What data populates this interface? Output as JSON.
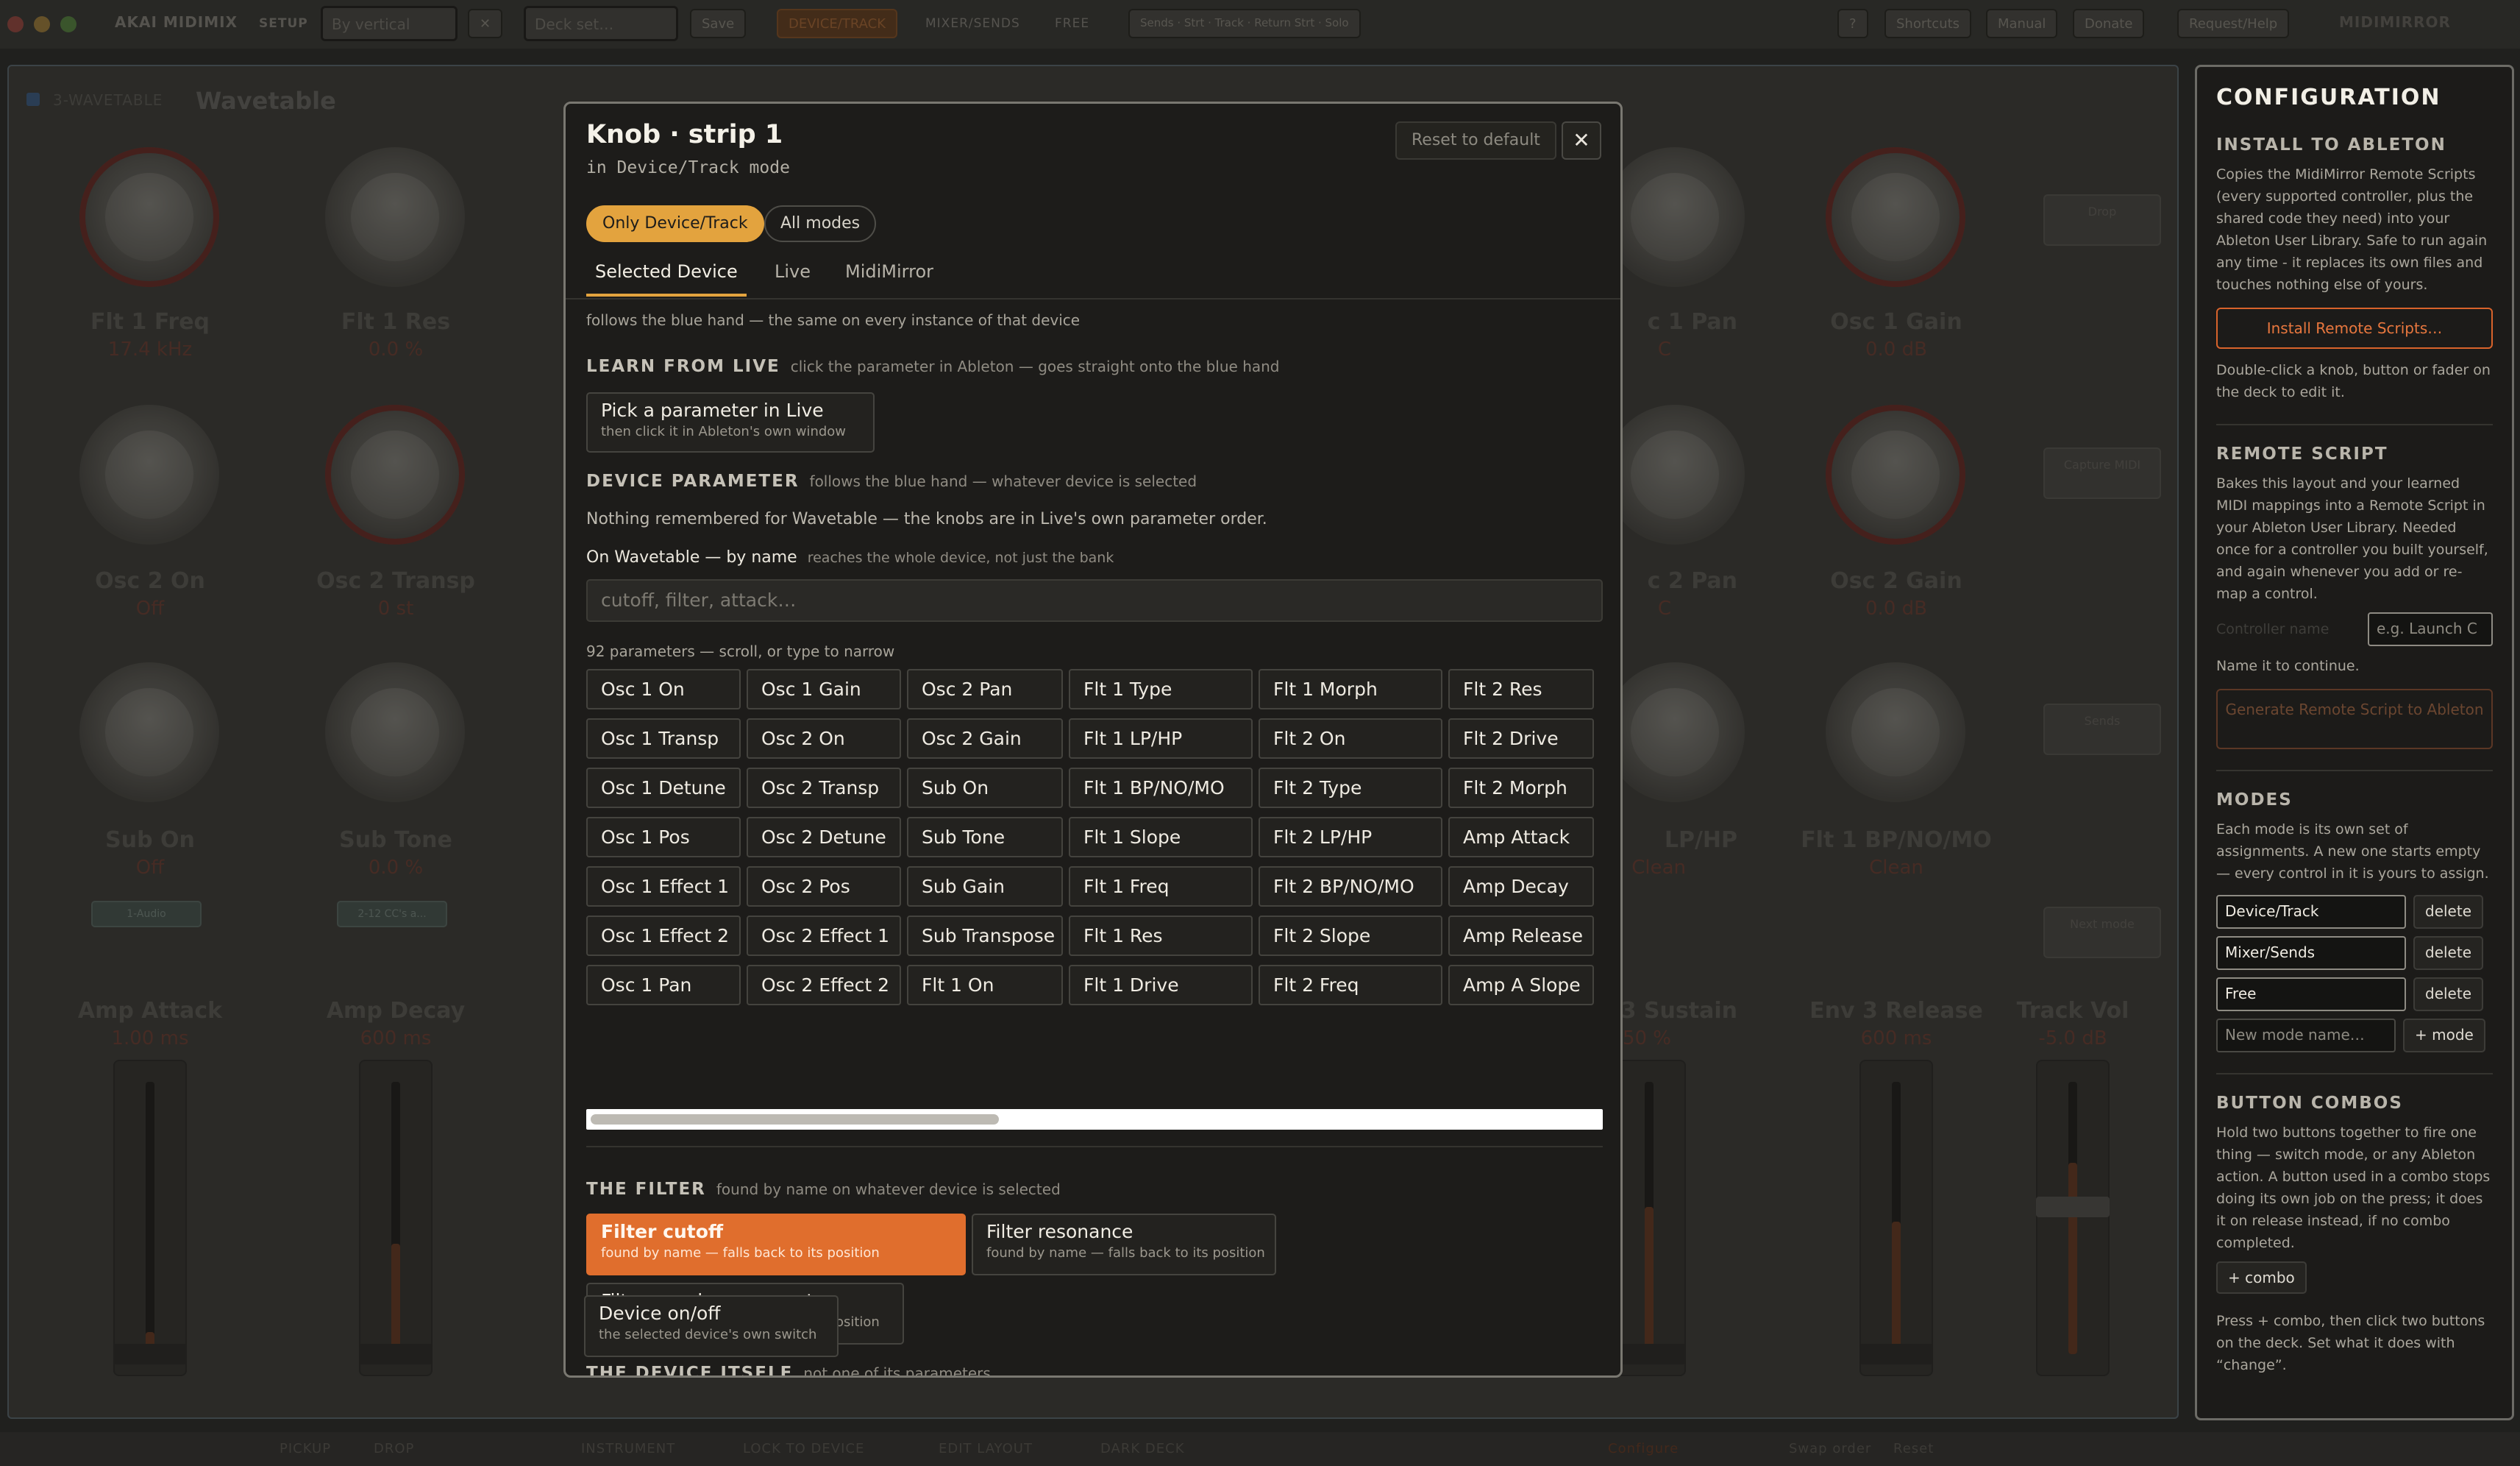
{
  "app": {
    "name": "AKAI MIDIMIX",
    "setup_label": "SETUP",
    "setup_value": "By vertical",
    "close_x": "✕",
    "search_placeholder": "Deck set…",
    "save_label": "Save",
    "mode_tabs": [
      "DEVICE/TRACK",
      "MIXER/SENDS",
      "FREE"
    ],
    "extra_tabs": "Sends · Strt · Track · Return Strt · Solo",
    "right_buttons": [
      "?",
      "Shortcuts",
      "Manual",
      "Donate",
      "Request/Help"
    ],
    "brand": "MIDIMIRROR"
  },
  "deck": {
    "device_tag": "3-WAVETABLE",
    "device_name": "Wavetable",
    "knobs": [
      {
        "label": "Flt 1 Freq",
        "value": "17.4 kHz"
      },
      {
        "label": "Flt 1 Res",
        "value": "0.0 %"
      },
      {
        "label": "Osc 2 On",
        "value": "Off"
      },
      {
        "label": "Osc 2 Transp",
        "value": "0 st"
      },
      {
        "label": "Sub On",
        "value": "Off"
      },
      {
        "label": "Sub Tone",
        "value": "0.0 %"
      },
      {
        "label": "c 1 Pan",
        "value": "C"
      },
      {
        "label": "Osc 1 Gain",
        "value": "0.0 dB"
      },
      {
        "label": "c 2 Pan",
        "value": "C"
      },
      {
        "label": "Osc 2 Gain",
        "value": "0.0 dB"
      },
      {
        "label": "LP/HP",
        "value": "Clean"
      },
      {
        "label": "Flt 1 BP/NO/MO",
        "value": "Clean"
      }
    ],
    "faders": [
      {
        "label": "Amp Attack",
        "value": "1.00 ms"
      },
      {
        "label": "Amp Decay",
        "value": "600 ms"
      },
      {
        "label": "3 Sustain",
        "value": "50 %"
      },
      {
        "label": "Env 3 Release",
        "value": "600 ms"
      },
      {
        "label": "Track Vol",
        "value": "-5.0 dB"
      }
    ],
    "strip_tags": [
      "1-Audio",
      "2-12 CC's a..."
    ],
    "side_buttons": [
      "Drop",
      "Capture MIDI",
      "Sends",
      "Next mode"
    ]
  },
  "bottom": {
    "items": [
      "PICKUP",
      "DROP",
      "INSTRUMENT",
      "LOCK TO DEVICE",
      "EDIT LAYOUT",
      "DARK DECK",
      "Configure",
      "Swap order",
      "Reset"
    ]
  },
  "modal": {
    "title": "Knob · strip 1",
    "subtitle": "in Device/Track mode",
    "reset_label": "Reset to default",
    "close_label": "✕",
    "scope_pills": [
      "Only Device/Track",
      "All modes"
    ],
    "tabs": [
      "Selected Device",
      "Live",
      "MidiMirror"
    ],
    "follows_note": "follows the blue hand — the same on every instance of that device",
    "learn": {
      "heading": "LEARN FROM LIVE",
      "hint": "click the parameter in Ableton — goes straight onto the blue hand",
      "card_title": "Pick a parameter in Live",
      "card_sub": "then click it in Ableton's own window"
    },
    "device_param": {
      "heading": "DEVICE PARAMETER",
      "hint": "follows the blue hand — whatever device is selected",
      "note": "Nothing remembered for Wavetable — the knobs are in Live's own parameter order.",
      "by_name_label": "On Wavetable — by name",
      "by_name_hint": "reaches the whole device, not just the bank",
      "search_placeholder": "cutoff, filter, attack…",
      "count_note": "92 parameters — scroll, or type to narrow",
      "params": [
        "Osc 1 On",
        "Osc 1 Gain",
        "Osc 2 Pan",
        "Flt 1 Type",
        "Flt 1 Morph",
        "Flt 2 Res",
        "Osc 1 Transp",
        "Osc 2 On",
        "Osc 2 Gain",
        "Flt 1 LP/HP",
        "Flt 2 On",
        "Flt 2 Drive",
        "Osc 1 Detune",
        "Osc 2 Transp",
        "Sub On",
        "Flt 1 BP/NO/MO",
        "Flt 2 Type",
        "Flt 2 Morph",
        "Osc 1 Pos",
        "Osc 2 Detune",
        "Sub Tone",
        "Flt 1 Slope",
        "Flt 2 LP/HP",
        "Amp Attack",
        "Osc 1 Effect 1",
        "Osc 2 Pos",
        "Sub Gain",
        "Flt 1 Freq",
        "Flt 2 BP/NO/MO",
        "Amp Decay",
        "Osc 1 Effect 2",
        "Osc 2 Effect 1",
        "Sub Transpose",
        "Flt 1 Res",
        "Flt 2 Slope",
        "Amp Release",
        "Osc 1 Pan",
        "Osc 2 Effect 2",
        "Flt 1 On",
        "Flt 1 Drive",
        "Flt 2 Freq",
        "Amp A Slope"
      ]
    },
    "filter": {
      "heading": "THE FILTER",
      "hint": "found by name on whatever device is selected",
      "cards": [
        {
          "title": "Filter cutoff",
          "sub": "found by name — falls back to its position"
        },
        {
          "title": "Filter resonance",
          "sub": "found by name — falls back to its position"
        },
        {
          "title": "Filter envelope amount",
          "sub": "found by name — falls back to its position"
        }
      ]
    },
    "device_itself": {
      "heading": "THE DEVICE ITSELF",
      "hint": "not one of its parameters",
      "card_title": "Device on/off",
      "card_sub": "the selected device's own switch"
    }
  },
  "config": {
    "title": "CONFIGURATION",
    "install": {
      "heading": "INSTALL TO ABLETON",
      "text": "Copies the MidiMirror Remote Scripts (every supported controller, plus the shared code they need) into your Ableton User Library. Safe to run again any time - it replaces its own files and touches nothing else of yours.",
      "button": "Install Remote Scripts…",
      "after": "Double-click a knob, button or fader on the deck to edit it."
    },
    "remote": {
      "heading": "REMOTE SCRIPT",
      "text": "Bakes this layout and your learned MIDI mappings into a Remote Script in your Ableton User Library. Needed once for a controller you built yourself, and again whenever you add or re-map a control.",
      "name_label": "Controller name",
      "name_placeholder": "e.g. Launch C",
      "name_note": "Name it to continue.",
      "button": "Generate Remote Script to Ableton"
    },
    "modes": {
      "heading": "MODES",
      "text": "Each mode is its own set of assignments. A new one starts empty — every control in it is yours to assign.",
      "items": [
        "Device/Track",
        "Mixer/Sends",
        "Free"
      ],
      "delete_label": "delete",
      "new_placeholder": "New mode name…",
      "add_label": "+ mode"
    },
    "combos": {
      "heading": "BUTTON COMBOS",
      "text": "Hold two buttons together to fire one thing — switch mode, or any Ableton action. A button used in a combo stops doing its own job on the press; it does it on release instead, if no combo completed.",
      "add_label": "+ combo",
      "after": "Press + combo, then click two buttons on the deck. Set what it does with “change”."
    }
  }
}
